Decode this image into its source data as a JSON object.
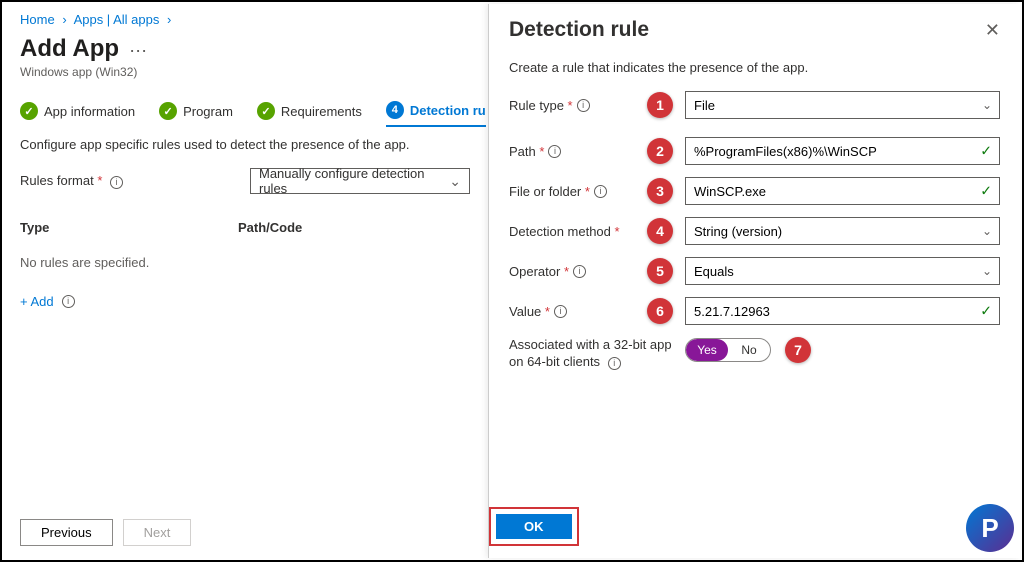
{
  "breadcrumb": {
    "home": "Home",
    "apps": "Apps | All apps"
  },
  "page": {
    "title": "Add App",
    "subtitle": "Windows app (Win32)"
  },
  "steps": {
    "app_info": "App information",
    "program": "Program",
    "requirements": "Requirements",
    "detection": "Detection rules"
  },
  "main": {
    "description": "Configure app specific rules used to detect the presence of the app.",
    "rules_format_label": "Rules format",
    "rules_format_value": "Manually configure detection rules",
    "col_type": "Type",
    "col_path": "Path/Code",
    "empty_text": "No rules are specified.",
    "add_label": "+ Add"
  },
  "buttons": {
    "previous": "Previous",
    "next": "Next",
    "ok": "OK"
  },
  "panel": {
    "title": "Detection rule",
    "description": "Create a rule that indicates the presence of the app.",
    "rule_type_label": "Rule type",
    "rule_type_value": "File",
    "path_label": "Path",
    "path_value": "%ProgramFiles(x86)%\\WinSCP",
    "file_label": "File or folder",
    "file_value": "WinSCP.exe",
    "detection_method_label": "Detection method",
    "detection_method_value": "String (version)",
    "operator_label": "Operator",
    "operator_value": "Equals",
    "value_label": "Value",
    "value_value": "5.21.7.12963",
    "assoc_label_line1": "Associated with a 32-bit app",
    "assoc_label_line2": "on 64-bit clients",
    "toggle_yes": "Yes",
    "toggle_no": "No"
  },
  "callouts": {
    "c1": "1",
    "c2": "2",
    "c3": "3",
    "c4": "4",
    "c5": "5",
    "c6": "6",
    "c7": "7"
  }
}
